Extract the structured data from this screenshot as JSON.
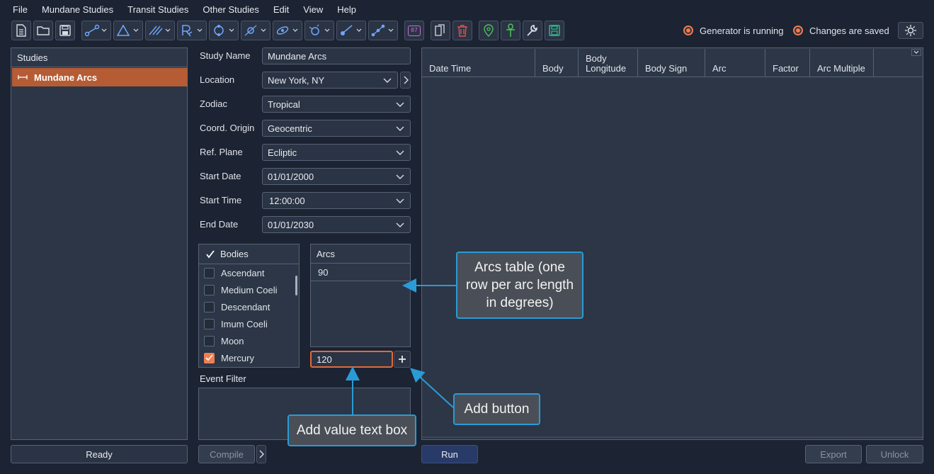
{
  "menu": [
    "File",
    "Mundane Studies",
    "Transit Studies",
    "Other Studies",
    "Edit",
    "View",
    "Help"
  ],
  "status": {
    "generator": "Generator is running",
    "saved": "Changes are saved"
  },
  "toolbar": {
    "date_badge": "07"
  },
  "studies": {
    "header": "Studies",
    "items": [
      "Mundane Arcs"
    ],
    "status": "Ready"
  },
  "form": {
    "fields": [
      {
        "label": "Study Name",
        "value": "Mundane Arcs"
      },
      {
        "label": "Location",
        "value": "New York, NY"
      },
      {
        "label": "Zodiac",
        "value": "Tropical"
      },
      {
        "label": "Coord. Origin",
        "value": "Geocentric"
      },
      {
        "label": "Ref. Plane",
        "value": "Ecliptic"
      },
      {
        "label": "Start Date",
        "value": "01/01/2000"
      },
      {
        "label": "Start Time",
        "value": "12:00:00"
      },
      {
        "label": "End Date",
        "value": "01/01/2030"
      }
    ]
  },
  "bodies": {
    "header": "Bodies",
    "items": [
      {
        "label": "Ascendant",
        "checked": false
      },
      {
        "label": "Medium Coeli",
        "checked": false
      },
      {
        "label": "Descendant",
        "checked": false
      },
      {
        "label": "Imum Coeli",
        "checked": false
      },
      {
        "label": "Moon",
        "checked": false
      },
      {
        "label": "Mercury",
        "checked": true
      }
    ]
  },
  "arcs": {
    "header": "Arcs",
    "rows": [
      "90"
    ],
    "input_value": "120"
  },
  "event_filter": {
    "label": "Event Filter"
  },
  "buttons": {
    "compile": "Compile",
    "run": "Run",
    "export": "Export",
    "unlock": "Unlock"
  },
  "results": {
    "columns": [
      "Date Time",
      "Body",
      "Body Longitude",
      "Body Sign",
      "Arc",
      "Factor",
      "Arc Multiple"
    ]
  },
  "callouts": {
    "arcs_table": "Arcs table (one row per arc length in degrees)",
    "add_button": "Add button",
    "add_value": "Add value text box"
  },
  "colors": {
    "accent": "#b55c35",
    "callout_border": "#2a9bd6",
    "run_button": "#283a67"
  }
}
